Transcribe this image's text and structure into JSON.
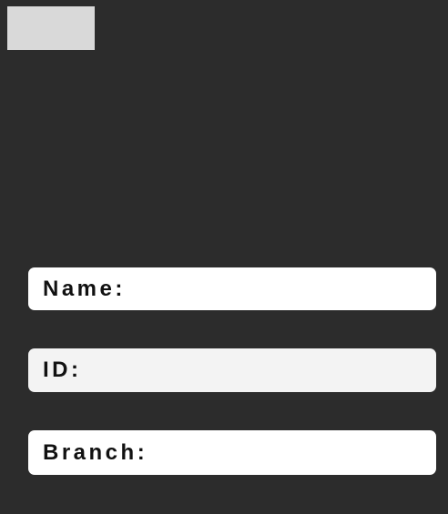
{
  "toolbar": {
    "top_button_label": ""
  },
  "form": {
    "fields": [
      {
        "label": "Name:"
      },
      {
        "label": "ID:"
      },
      {
        "label": "Branch:"
      }
    ]
  },
  "colors": {
    "background": "#2c2c2c",
    "button": "#d9d9d9",
    "field_bg": "#ffffff",
    "field_bg_alt": "#f3f3f3",
    "text": "#111111"
  }
}
